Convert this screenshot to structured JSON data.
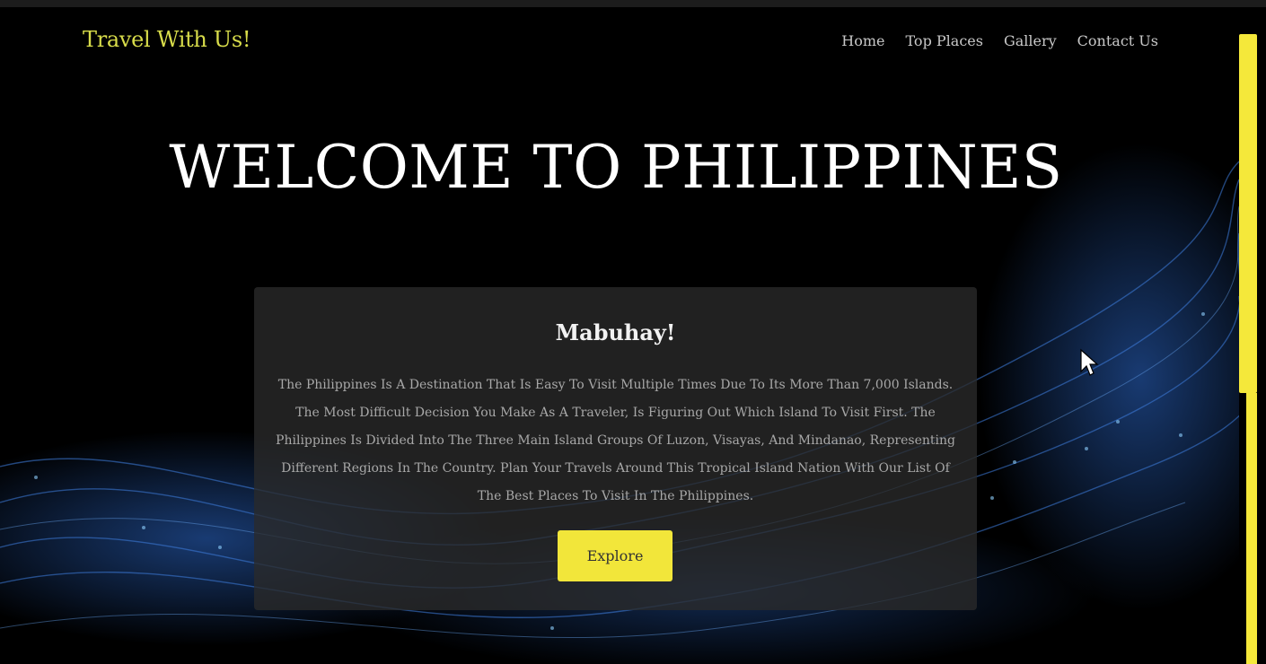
{
  "navbar": {
    "brand": "Travel With Us!",
    "links": [
      "Home",
      "Top Places",
      "Gallery",
      "Contact Us"
    ]
  },
  "hero": {
    "title": "WELCOME TO PHILIPPINES"
  },
  "card": {
    "heading": "Mabuhay!",
    "body": "The Philippines Is A Destination That Is Easy To Visit Multiple Times Due To Its More Than 7,000 Islands. The Most Difficult Decision You Make As A Traveler, Is Figuring Out Which Island To Visit First. The Philippines Is Divided Into The Three Main Island Groups Of Luzon, Visayas, And Mindanao, Representing Different Regions In The Country. Plan Your Travels Around This Tropical Island Nation With Our List Of The Best Places To Visit In The Philippines.",
    "button_label": "Explore"
  },
  "colors": {
    "background": "#000000",
    "brand": "#d8dc4a",
    "accent": "#f2e63a",
    "wave": "#2d6bd0"
  },
  "icons": {
    "cursor": "mouse-pointer-icon"
  }
}
